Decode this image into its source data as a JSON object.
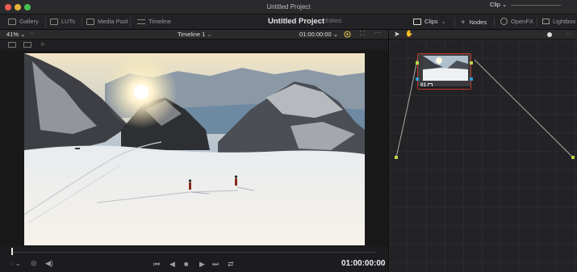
{
  "window": {
    "title": "Untitled Project"
  },
  "toolbar": {
    "gallery": "Gallery",
    "luts": "LUTs",
    "media_pool": "Media Pool",
    "timeline": "Timeline",
    "project_name": "Untitled Project",
    "project_status": "Edited",
    "clips": "Clips",
    "nodes": "Nodes",
    "openfx": "OpenFX",
    "lightbox": "Lightbox"
  },
  "viewer": {
    "zoom": "41%",
    "timeline_name": "Timeline 1",
    "timecode_header": "01:00:00:00",
    "timecode": "01:00:00:00",
    "playhead_progress": 0.0
  },
  "node_editor": {
    "mode": "Clip",
    "node_label": "01"
  },
  "colors": {
    "accent_yellow": "#e6c84a",
    "node_border": "#c0392b",
    "port_green": "#b7d84a",
    "port_blue": "#2d9cdb"
  }
}
